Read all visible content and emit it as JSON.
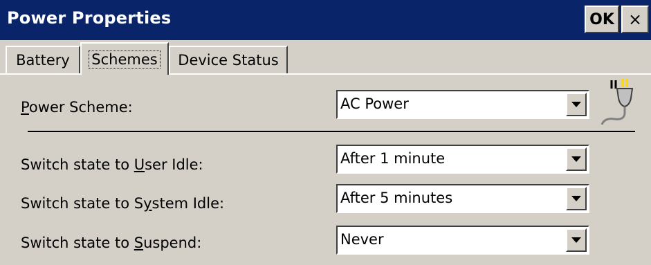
{
  "window": {
    "title": "Power Properties",
    "ok_label": "OK",
    "close_label": "×"
  },
  "tabs": [
    {
      "label": "Battery",
      "selected": false
    },
    {
      "label": "Schemes",
      "selected": true
    },
    {
      "label": "Device Status",
      "selected": false
    }
  ],
  "scheme": {
    "label_prefix": "",
    "label_u": "P",
    "label_rest": "ower Scheme:",
    "value": "AC Power",
    "icon": "power-plug-icon"
  },
  "settings": [
    {
      "label_prefix": "Switch state to ",
      "label_u": "U",
      "label_rest": "ser Idle:",
      "value": "After 1 minute"
    },
    {
      "label_prefix": "Switch state to S",
      "label_u": "y",
      "label_rest": "stem Idle:",
      "value": "After 5 minutes"
    },
    {
      "label_prefix": "Switch state to ",
      "label_u": "S",
      "label_rest": "uspend:",
      "value": "Never"
    }
  ],
  "colors": {
    "titlebar": "#0a246a",
    "face": "#d4d0c8"
  }
}
